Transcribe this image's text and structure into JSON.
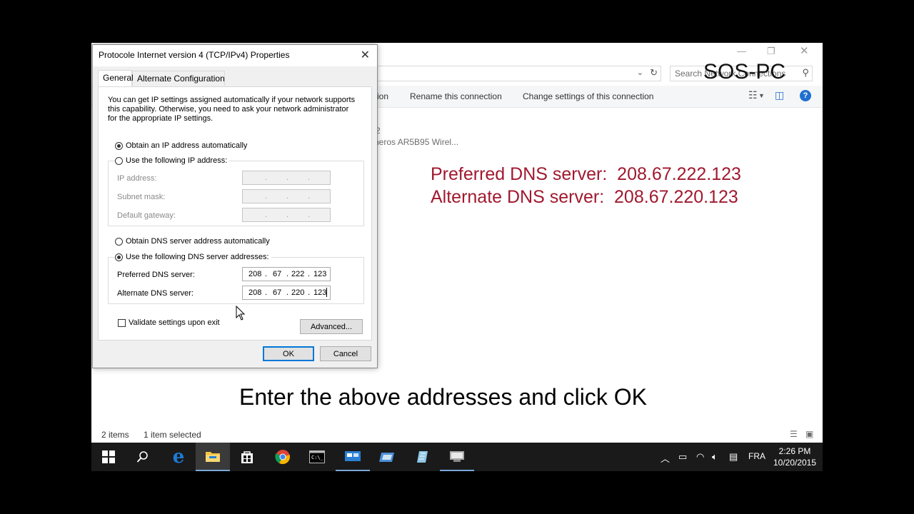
{
  "watermark": "SOS-PC",
  "explorer": {
    "search_placeholder": "Search Network Connections",
    "commands": [
      {
        "label": "ion"
      },
      {
        "label": "Rename this connection"
      },
      {
        "label": "Change settings of this connection"
      }
    ],
    "connection_line1": "2",
    "connection_line2": "heros AR5B95 Wirel..."
  },
  "overlay": {
    "preferred_line": "Preferred DNS server:  208.67.222.123",
    "alternate_line": "Alternate DNS server:  208.67.220.123",
    "instruction": "Enter the above addresses and click OK"
  },
  "status": {
    "items_count": "2 items",
    "selected": "1 item selected"
  },
  "dialog": {
    "title": "Protocole Internet version 4 (TCP/IPv4) Properties",
    "tabs": [
      {
        "label": "General"
      },
      {
        "label": "Alternate Configuration"
      }
    ],
    "description": "You can get IP settings assigned automatically if your network supports this capability. Otherwise, you need to ask your network administrator for the appropriate IP settings.",
    "ip_auto_label": "Obtain an IP address automatically",
    "ip_manual_label": "Use the following IP address:",
    "ip_address_label": "IP address:",
    "subnet_label": "Subnet mask:",
    "gateway_label": "Default gateway:",
    "dns_auto_label": "Obtain DNS server address automatically",
    "dns_manual_label": "Use the following DNS server addresses:",
    "preferred_label": "Preferred DNS server:",
    "alternate_label": "Alternate DNS server:",
    "preferred_dns": [
      "208",
      "67",
      "222",
      "123"
    ],
    "alternate_dns": [
      "208",
      "67",
      "220",
      "123"
    ],
    "validate_label": "Validate settings upon exit",
    "advanced_label": "Advanced...",
    "ok_label": "OK",
    "cancel_label": "Cancel"
  },
  "taskbar": {
    "language": "FRA",
    "time": "2:26 PM",
    "date": "10/20/2015"
  },
  "colors": {
    "overlay_text": "#a0192f",
    "accent": "#0078d7",
    "taskbar": "#1a1a1a"
  }
}
